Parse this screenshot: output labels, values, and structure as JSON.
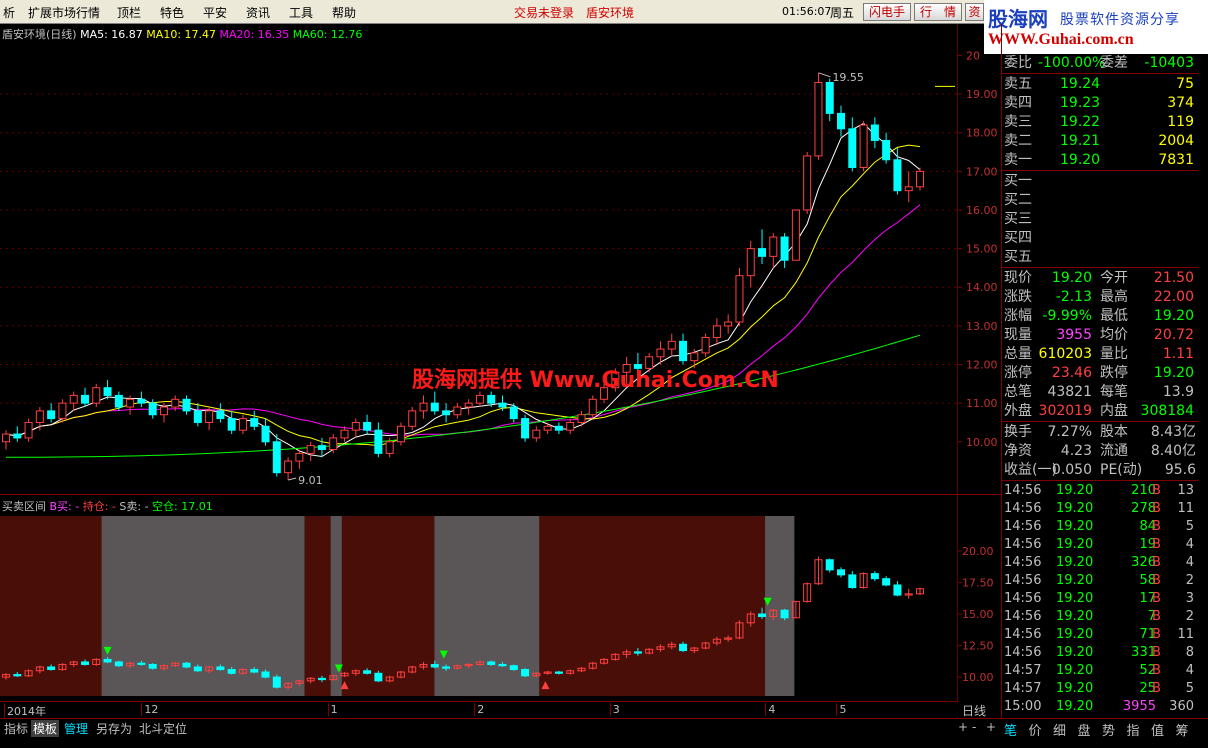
{
  "menu": {
    "items": [
      "析",
      "扩展市场行情",
      "顶栏",
      "特色",
      "平安",
      "资讯",
      "工具",
      "帮助"
    ],
    "status": "交易未登录",
    "stock": "盾安环境",
    "clock": "01:56:07",
    "weekday": "周五",
    "buttons": [
      "闪电手",
      "行　情",
      "资"
    ]
  },
  "brand": {
    "logo": "股海网",
    "slogan": "股票软件资源分享",
    "url": "WWW.Guhai.com.cn"
  },
  "watermark": "股海网提供 Www.Guhai.Com.CN",
  "main_chart": {
    "title": "盾安环境(日线)",
    "ma": [
      {
        "label": "MA5:",
        "value": "16.87",
        "color": "#ffffff"
      },
      {
        "label": "MA10:",
        "value": "17.47",
        "color": "#ffff00"
      },
      {
        "label": "MA20:",
        "value": "16.35",
        "color": "#ff00ff"
      },
      {
        "label": "MA60:",
        "value": "12.76",
        "color": "#00ff00"
      }
    ],
    "high_label": "19.55",
    "low_label": "9.01",
    "y_ticks": [
      "20",
      "19.00",
      "18.00",
      "17.00",
      "16.00",
      "15.00",
      "14.00",
      "13.00",
      "12.00",
      "11.00",
      "10.00"
    ],
    "corner_icon": "diamond-icon"
  },
  "sub_chart": {
    "title": "买卖区间",
    "indicators": [
      {
        "label": "B买:",
        "value": "-",
        "color": "#ff44ff"
      },
      {
        "label": "持仓:",
        "value": "-",
        "color": "#ff4040"
      },
      {
        "label": "S卖:",
        "value": "-",
        "color": "#c0c0c0"
      },
      {
        "label": "空仓:",
        "value": "17.01",
        "color": "#00ff00"
      }
    ],
    "y_ticks": [
      "20.00",
      "17.50",
      "15.00",
      "12.50",
      "10.00"
    ]
  },
  "date_axis": [
    "2014年",
    "12",
    "1",
    "2",
    "3",
    "4",
    "5"
  ],
  "period_label": "日线",
  "quote": {
    "weibi": {
      "label": "委比",
      "value": "-100.00%",
      "label2": "委差",
      "value2": "-10403"
    },
    "asks": [
      {
        "label": "卖五",
        "price": "19.24",
        "vol": "75"
      },
      {
        "label": "卖四",
        "price": "19.23",
        "vol": "374"
      },
      {
        "label": "卖三",
        "price": "19.22",
        "vol": "119"
      },
      {
        "label": "卖二",
        "price": "19.21",
        "vol": "2004"
      },
      {
        "label": "卖一",
        "price": "19.20",
        "vol": "7831"
      }
    ],
    "bids": [
      "买一",
      "买二",
      "买三",
      "买四",
      "买五"
    ],
    "stats": [
      {
        "l1": "现价",
        "v1": "19.20",
        "c1": "#00ff00",
        "l2": "今开",
        "v2": "21.50",
        "c2": "#ff4040"
      },
      {
        "l1": "涨跌",
        "v1": "-2.13",
        "c1": "#00ff00",
        "l2": "最高",
        "v2": "22.00",
        "c2": "#ff4040"
      },
      {
        "l1": "涨幅",
        "v1": "-9.99%",
        "c1": "#00ff00",
        "l2": "最低",
        "v2": "19.20",
        "c2": "#00ff00"
      },
      {
        "l1": "现量",
        "v1": "3955",
        "c1": "#ff44ff",
        "l2": "均价",
        "v2": "20.72",
        "c2": "#ff4040"
      },
      {
        "l1": "总量",
        "v1": "610203",
        "c1": "#ffff00",
        "l2": "量比",
        "v2": "1.11",
        "c2": "#ff4040"
      },
      {
        "l1": "涨停",
        "v1": "23.46",
        "c1": "#ff4040",
        "l2": "跌停",
        "v2": "19.20",
        "c2": "#00ff00"
      },
      {
        "l1": "总笔",
        "v1": "43821",
        "c1": "#c0c0c0",
        "l2": "每笔",
        "v2": "13.9",
        "c2": "#c0c0c0"
      },
      {
        "l1": "外盘",
        "v1": "302019",
        "c1": "#ff4040",
        "l2": "内盘",
        "v2": "308184",
        "c2": "#00ff00"
      }
    ],
    "fundamentals": [
      {
        "l1": "换手",
        "v1": "7.27%",
        "l2": "股本",
        "v2": "8.43亿"
      },
      {
        "l1": "净资",
        "v1": "4.23",
        "l2": "流通",
        "v2": "8.40亿"
      },
      {
        "l1": "收益(一)",
        "v1": "0.050",
        "l2": "PE(动)",
        "v2": "95.6"
      }
    ],
    "ticks": [
      {
        "time": "14:56",
        "price": "19.20",
        "vol": "210",
        "side": "B",
        "n": "13"
      },
      {
        "time": "14:56",
        "price": "19.20",
        "vol": "278",
        "side": "B",
        "n": "11"
      },
      {
        "time": "14:56",
        "price": "19.20",
        "vol": "84",
        "side": "B",
        "n": "5"
      },
      {
        "time": "14:56",
        "price": "19.20",
        "vol": "19",
        "side": "B",
        "n": "4"
      },
      {
        "time": "14:56",
        "price": "19.20",
        "vol": "326",
        "side": "B",
        "n": "4"
      },
      {
        "time": "14:56",
        "price": "19.20",
        "vol": "58",
        "side": "B",
        "n": "2"
      },
      {
        "time": "14:56",
        "price": "19.20",
        "vol": "17",
        "side": "B",
        "n": "3"
      },
      {
        "time": "14:56",
        "price": "19.20",
        "vol": "7",
        "side": "B",
        "n": "2"
      },
      {
        "time": "14:56",
        "price": "19.20",
        "vol": "71",
        "side": "B",
        "n": "11"
      },
      {
        "time": "14:56",
        "price": "19.20",
        "vol": "331",
        "side": "B",
        "n": "8"
      },
      {
        "time": "14:57",
        "price": "19.20",
        "vol": "52",
        "side": "B",
        "n": "4"
      },
      {
        "time": "14:57",
        "price": "19.20",
        "vol": "25",
        "side": "B",
        "n": "5"
      },
      {
        "time": "15:00",
        "price": "19.20",
        "vol": "3955",
        "side": "",
        "n": "360"
      }
    ]
  },
  "bottom_tabs": [
    "指标",
    "模板",
    "管理",
    "另存为",
    "北斗定位"
  ],
  "right_tabs": [
    "笔",
    "价",
    "细",
    "盘",
    "势",
    "指",
    "值",
    "筹"
  ],
  "scroll_buttons": [
    "+",
    "-",
    "+"
  ],
  "colors": {
    "up": "#ff4040",
    "down": "#00ffff",
    "ma5": "#ffffff",
    "ma10": "#ffff00",
    "ma20": "#ff00ff",
    "ma60": "#00ff00",
    "hold_zone": "#4a0e08",
    "empty_zone": "#5a5658"
  },
  "chart_data": {
    "type": "candlestick",
    "title": "盾安环境(日线)",
    "ylim": [
      8.7,
      20.4
    ],
    "high": 19.55,
    "low": 9.01,
    "bars": [
      [
        10.0,
        10.3,
        9.8,
        10.2
      ],
      [
        10.2,
        10.4,
        10.0,
        10.1
      ],
      [
        10.1,
        10.6,
        10.0,
        10.5
      ],
      [
        10.5,
        10.9,
        10.3,
        10.8
      ],
      [
        10.8,
        11.0,
        10.5,
        10.6
      ],
      [
        10.6,
        11.1,
        10.5,
        11.0
      ],
      [
        11.0,
        11.3,
        10.8,
        11.2
      ],
      [
        11.2,
        11.4,
        10.9,
        11.0
      ],
      [
        11.0,
        11.5,
        10.9,
        11.4
      ],
      [
        11.4,
        11.6,
        11.1,
        11.2
      ],
      [
        11.2,
        11.3,
        10.8,
        10.9
      ],
      [
        10.9,
        11.2,
        10.7,
        11.1
      ],
      [
        11.1,
        11.3,
        10.9,
        11.0
      ],
      [
        11.0,
        11.1,
        10.6,
        10.7
      ],
      [
        10.7,
        11.0,
        10.5,
        10.9
      ],
      [
        10.9,
        11.2,
        10.8,
        11.1
      ],
      [
        11.1,
        11.2,
        10.7,
        10.8
      ],
      [
        10.8,
        11.0,
        10.4,
        10.5
      ],
      [
        10.5,
        10.9,
        10.3,
        10.8
      ],
      [
        10.8,
        11.0,
        10.5,
        10.6
      ],
      [
        10.6,
        10.8,
        10.2,
        10.3
      ],
      [
        10.3,
        10.7,
        10.2,
        10.6
      ],
      [
        10.6,
        10.8,
        10.3,
        10.4
      ],
      [
        10.4,
        10.6,
        9.9,
        10.0
      ],
      [
        10.0,
        10.2,
        9.1,
        9.2
      ],
      [
        9.2,
        9.6,
        9.01,
        9.5
      ],
      [
        9.5,
        9.8,
        9.3,
        9.7
      ],
      [
        9.7,
        10.0,
        9.5,
        9.9
      ],
      [
        9.9,
        10.1,
        9.6,
        9.8
      ],
      [
        9.8,
        10.2,
        9.7,
        10.1
      ],
      [
        10.1,
        10.4,
        10.0,
        10.3
      ],
      [
        10.3,
        10.6,
        10.1,
        10.5
      ],
      [
        10.5,
        10.7,
        10.2,
        10.3
      ],
      [
        10.3,
        10.5,
        9.6,
        9.7
      ],
      [
        9.7,
        10.1,
        9.6,
        10.0
      ],
      [
        10.0,
        10.5,
        9.9,
        10.4
      ],
      [
        10.4,
        10.9,
        10.3,
        10.8
      ],
      [
        10.8,
        11.2,
        10.6,
        11.0
      ],
      [
        11.0,
        11.3,
        10.7,
        10.8
      ],
      [
        10.8,
        11.0,
        10.5,
        10.7
      ],
      [
        10.7,
        11.0,
        10.6,
        10.9
      ],
      [
        10.9,
        11.1,
        10.7,
        11.0
      ],
      [
        11.0,
        11.3,
        10.9,
        11.2
      ],
      [
        11.2,
        11.3,
        10.9,
        11.0
      ],
      [
        11.0,
        11.2,
        10.8,
        10.9
      ],
      [
        10.9,
        11.0,
        10.5,
        10.6
      ],
      [
        10.6,
        10.7,
        10.0,
        10.1
      ],
      [
        10.1,
        10.4,
        10.0,
        10.3
      ],
      [
        10.3,
        10.5,
        10.2,
        10.4
      ],
      [
        10.4,
        10.5,
        10.2,
        10.3
      ],
      [
        10.3,
        10.6,
        10.2,
        10.5
      ],
      [
        10.5,
        10.8,
        10.4,
        10.7
      ],
      [
        10.7,
        11.2,
        10.6,
        11.1
      ],
      [
        11.1,
        11.5,
        11.0,
        11.4
      ],
      [
        11.4,
        11.9,
        11.3,
        11.8
      ],
      [
        11.8,
        12.2,
        11.5,
        12.0
      ],
      [
        12.0,
        12.3,
        11.7,
        11.9
      ],
      [
        11.9,
        12.3,
        11.8,
        12.2
      ],
      [
        12.2,
        12.6,
        12.0,
        12.4
      ],
      [
        12.4,
        12.8,
        12.2,
        12.6
      ],
      [
        12.6,
        12.8,
        12.0,
        12.1
      ],
      [
        12.1,
        12.4,
        11.9,
        12.3
      ],
      [
        12.3,
        12.8,
        12.2,
        12.7
      ],
      [
        12.7,
        13.2,
        12.5,
        13.0
      ],
      [
        13.0,
        13.3,
        12.8,
        13.1
      ],
      [
        13.1,
        14.5,
        13.0,
        14.3
      ],
      [
        14.3,
        15.2,
        14.0,
        15.0
      ],
      [
        15.0,
        15.5,
        14.6,
        14.8
      ],
      [
        14.8,
        15.4,
        14.5,
        15.3
      ],
      [
        15.3,
        15.4,
        14.5,
        14.7
      ],
      [
        14.7,
        16.0,
        14.7,
        16.0
      ],
      [
        16.0,
        17.5,
        15.9,
        17.4
      ],
      [
        17.4,
        19.55,
        17.3,
        19.3
      ],
      [
        19.3,
        19.4,
        18.3,
        18.5
      ],
      [
        18.5,
        18.7,
        17.9,
        18.1
      ],
      [
        18.1,
        18.4,
        17.0,
        17.1
      ],
      [
        17.1,
        18.3,
        17.0,
        18.2
      ],
      [
        18.2,
        18.4,
        17.6,
        17.8
      ],
      [
        17.8,
        18.0,
        17.2,
        17.3
      ],
      [
        17.3,
        17.6,
        16.4,
        16.5
      ],
      [
        16.5,
        17.0,
        16.2,
        16.6
      ],
      [
        16.6,
        17.1,
        16.5,
        17.0
      ]
    ],
    "ma60_end": 12.76
  }
}
